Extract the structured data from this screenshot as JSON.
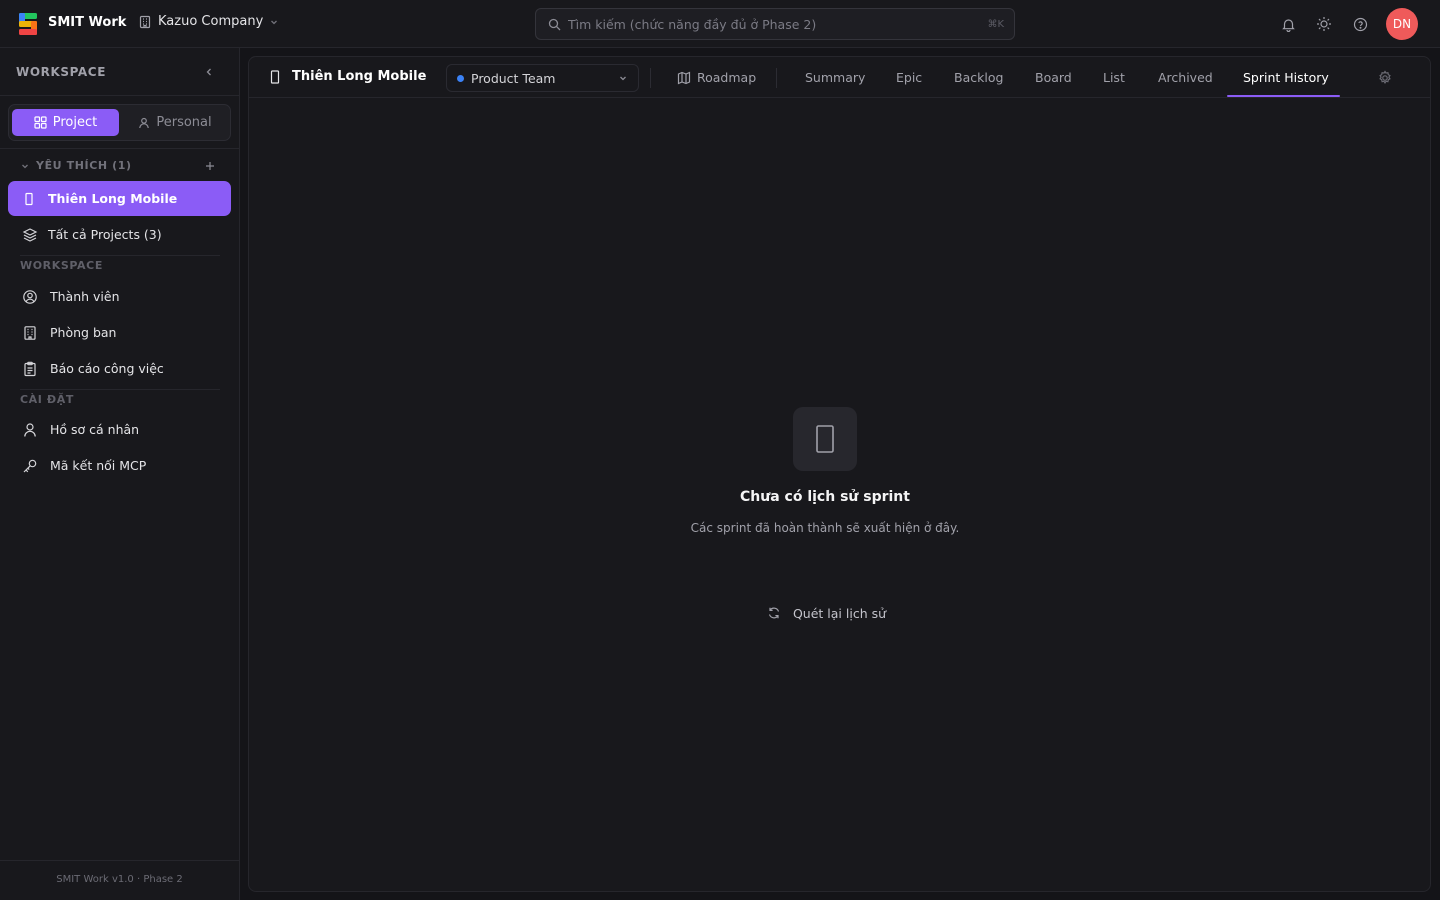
{
  "app": {
    "brand": "SMIT Work",
    "company": "Kazuo Company"
  },
  "search": {
    "placeholder": "Tìm kiếm (chức năng đầy đủ ở Phase 2)",
    "shortcut": "⌘K"
  },
  "user": {
    "initials": "DN",
    "avatar_color": "#ef5a5a"
  },
  "colors": {
    "accent": "#8b5cf6",
    "background": "#141418",
    "panel": "#18181c",
    "team_dot": "#3b82f6"
  },
  "sidebar": {
    "heading": "WORKSPACE",
    "toggle": {
      "project": "Project",
      "personal": "Personal",
      "selected": "project"
    },
    "favorites": {
      "label": "YÊU THÍCH (1)",
      "items": [
        {
          "label": "Thiên Long Mobile",
          "active": true
        }
      ]
    },
    "all_projects": "Tất cả Projects (3)",
    "workspace_label": "WORKSPACE",
    "workspace_items": [
      {
        "label": "Thành viên",
        "icon": "member-icon"
      },
      {
        "label": "Phòng ban",
        "icon": "building-icon"
      },
      {
        "label": "Báo cáo công việc",
        "icon": "clipboard-icon"
      }
    ],
    "settings_label": "CÀI ĐẶT",
    "settings_items": [
      {
        "label": "Hồ sơ cá nhân",
        "icon": "user-icon"
      },
      {
        "label": "Mã kết nối MCP",
        "icon": "key-icon"
      }
    ],
    "footer": "SMIT Work v1.0 · Phase 2"
  },
  "project": {
    "title": "Thiên Long Mobile",
    "team": "Product Team",
    "roadmap": "Roadmap",
    "tabs": [
      "Summary",
      "Epic",
      "Backlog",
      "Board",
      "List",
      "Archived",
      "Sprint History"
    ],
    "active_tab": "Sprint History"
  },
  "empty_state": {
    "title": "Chưa có lịch sử sprint",
    "description": "Các sprint đã hoàn thành sẽ xuất hiện ở đây.",
    "action": "Quét lại lịch sử"
  }
}
